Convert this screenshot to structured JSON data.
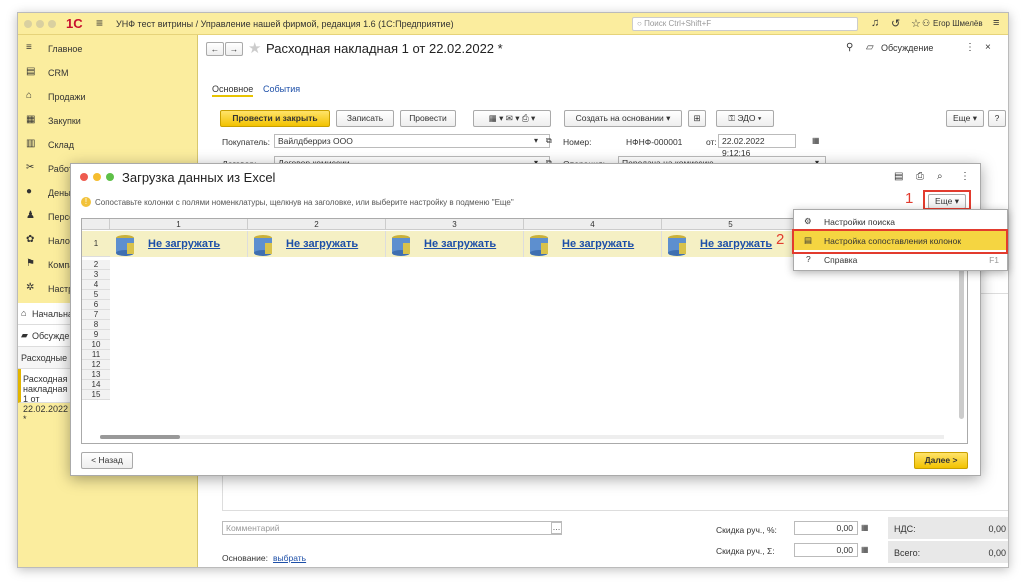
{
  "titlebar": {
    "logo": "1С",
    "app_title": "УНФ тест витрины / Управление нашей фирмой, редакция 1.6  (1С:Предприятие)",
    "search_placeholder": "Поиск Ctrl+Shift+F",
    "user": "Егор Шмелёв"
  },
  "sidebar": {
    "items": [
      {
        "label": "Главное",
        "icon": "menu-icon"
      },
      {
        "label": "CRM",
        "icon": "crm-icon"
      },
      {
        "label": "Продажи",
        "icon": "sales-icon"
      },
      {
        "label": "Закупки",
        "icon": "purchases-icon"
      },
      {
        "label": "Склад",
        "icon": "warehouse-icon"
      },
      {
        "label": "Работы",
        "icon": "works-icon"
      },
      {
        "label": "Деньги",
        "icon": "money-icon"
      },
      {
        "label": "Персонал",
        "icon": "staff-icon"
      },
      {
        "label": "Налоги",
        "icon": "taxes-icon"
      },
      {
        "label": "Компания",
        "icon": "company-icon"
      },
      {
        "label": "Настройки",
        "icon": "settings-icon"
      }
    ],
    "home": "Начальная страница",
    "discussions": "Обсуждения",
    "open1": "Расходные накладные",
    "open2": "Расходная накладная 1 от 22.02.2022 *"
  },
  "doc": {
    "title": "Расходная накладная 1 от 22.02.2022 *",
    "discussion": "Обсуждение",
    "tab_main": "Основное",
    "tab_events": "События",
    "btn_post_close": "Провести и закрыть",
    "btn_save": "Записать",
    "btn_post": "Провести",
    "btn_create_based": "Создать на основании",
    "btn_edo": "ЭДО",
    "btn_more": "Еще",
    "btn_help": "?",
    "buyer_label": "Покупатель:",
    "buyer_value": "Вайлдберриз ООО",
    "number_label": "Номер:",
    "number_value": "НФНФ-000001",
    "date_label": "от:",
    "date_value": "22.02.2022  9:12:16",
    "contract_label": "Договор:",
    "contract_value": "Договор комиссии",
    "operation_label": "Операция:",
    "operation_value": "Передача на комиссию",
    "comment_placeholder": "Комментарий",
    "discount_pct_label": "Скидка руч., %:",
    "discount_pct_value": "0,00",
    "discount_sum_label": "Скидка руч., Σ:",
    "discount_sum_value": "0,00",
    "vat_label": "НДС:",
    "vat_value": "0,00",
    "total_label": "Всего:",
    "total_value": "0,00",
    "basis_label": "Основание:",
    "basis_link": "выбрать"
  },
  "modal": {
    "title": "Загрузка данных из Excel",
    "hint": "Сопоставьте колонки с полями номенклатуры, щелкнув на заголовке, или выберите настройку в подменю \"Еще\"",
    "btn_more": "Еще",
    "btn_back": "< Назад",
    "btn_next": "Далее >",
    "columns": [
      "1",
      "2",
      "3",
      "4",
      "5"
    ],
    "cell_link": "Не загружать",
    "rows": [
      "1",
      "2",
      "3",
      "4",
      "5",
      "6",
      "7",
      "8",
      "9",
      "10",
      "11",
      "12",
      "13",
      "14",
      "15"
    ]
  },
  "menu": {
    "items": [
      {
        "label": "Настройки поиска",
        "shortcut": ""
      },
      {
        "label": "Настройка сопоставления колонок",
        "shortcut": ""
      },
      {
        "label": "Справка",
        "shortcut": "F1"
      }
    ]
  },
  "annotations": {
    "n1": "1",
    "n2": "2"
  },
  "colors": {
    "accent": "#fbed9e",
    "highlight": "#f5d541",
    "link": "#1d4fa8",
    "red": "#e23b2e"
  }
}
